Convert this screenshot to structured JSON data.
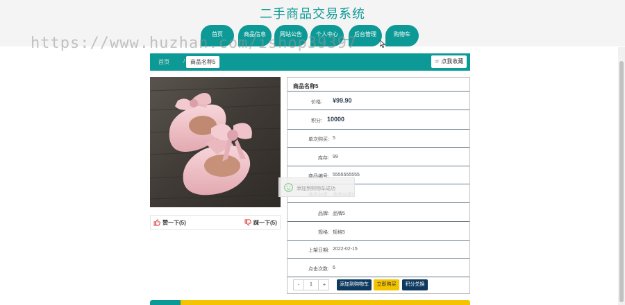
{
  "site": {
    "title": "二手商品交易系统"
  },
  "nav": [
    {
      "label": "首页"
    },
    {
      "label": "商品信息"
    },
    {
      "label": "网站公告"
    },
    {
      "label": "个人中心"
    },
    {
      "label": "后台管理"
    },
    {
      "label": "购物车"
    }
  ],
  "watermark": "https://www.huzhan.com/ishop39397",
  "breadcrumb": {
    "home": "首页",
    "separator": "/",
    "current": "商品名称5"
  },
  "favorite_label": "☆ 点我收藏",
  "product": {
    "name": "商品名称5",
    "likes_label": "赞一下(5)",
    "dislikes_label": "踩一下(5)",
    "fields": [
      {
        "label": "价格:",
        "value": "¥99.90",
        "emphasis": true
      },
      {
        "label": "积分:",
        "value": "10000",
        "emphasis": true
      },
      {
        "label": "单次购买:",
        "value": "5"
      },
      {
        "label": "库存:",
        "value": "99"
      },
      {
        "label": "商品编号:",
        "value": "5555555555"
      },
      {
        "label": "商品分类:",
        "value": "商品分类5"
      },
      {
        "label": "品牌:",
        "value": "品牌5"
      },
      {
        "label": "规格:",
        "value": "规格5"
      },
      {
        "label": "上架日期:",
        "value": "2022-02-15"
      },
      {
        "label": "点击次数:",
        "value": "6"
      }
    ]
  },
  "quantity": {
    "minus": "-",
    "value": "1",
    "plus": "+"
  },
  "actions": {
    "add_to_cart": "添加到购物车",
    "buy_now": "立即购买",
    "redeem_points": "积分兑换"
  },
  "toast": {
    "message": "添加到购物车成功"
  },
  "colors": {
    "teal": "#0d9a96",
    "navy": "#0f3a5f",
    "yellow": "#f5c400",
    "price": "#2a3c50"
  }
}
